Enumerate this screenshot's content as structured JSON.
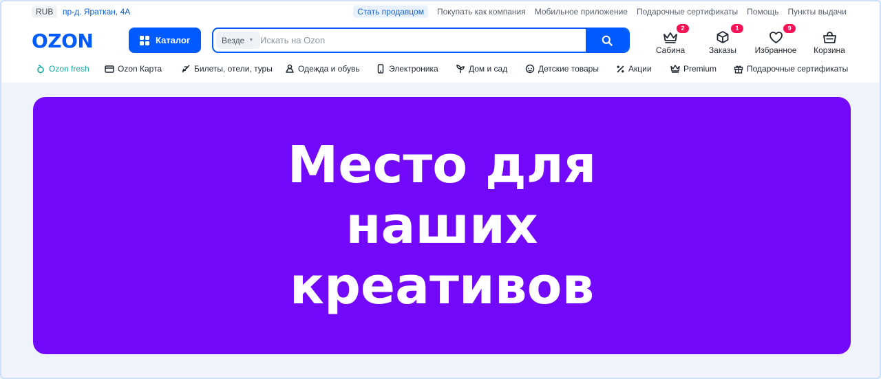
{
  "topbar": {
    "currency": "RUB",
    "address": "пр-д. Яраткан, 4А",
    "links": [
      "Стать продавцом",
      "Покупать как компания",
      "Мобильное приложение",
      "Подарочные сертификаты",
      "Помощь",
      "Пункты выдачи"
    ]
  },
  "header": {
    "logo": "OZON",
    "catalog_label": "Каталог",
    "search": {
      "scope": "Везде",
      "placeholder": "Искать на Ozon"
    },
    "actions": [
      {
        "label": "Сабина",
        "icon": "crown-icon",
        "badge": "2"
      },
      {
        "label": "Заказы",
        "icon": "box-icon",
        "badge": "1"
      },
      {
        "label": "Избранное",
        "icon": "heart-icon",
        "badge": "9"
      },
      {
        "label": "Корзина",
        "icon": "cart-icon",
        "badge": ""
      }
    ]
  },
  "categories": [
    {
      "label": "Ozon fresh",
      "icon": "fresh-icon"
    },
    {
      "label": "Ozon Карта",
      "icon": "card-icon"
    },
    {
      "label": "Билеты, отели, туры",
      "icon": "plane-icon"
    },
    {
      "label": "Одежда и обувь",
      "icon": "clothes-icon"
    },
    {
      "label": "Электроника",
      "icon": "phone-icon"
    },
    {
      "label": "Дом и сад",
      "icon": "plant-icon"
    },
    {
      "label": "Детские товары",
      "icon": "baby-icon"
    },
    {
      "label": "Акции",
      "icon": "percent-icon"
    },
    {
      "label": "Premium",
      "icon": "crown-icon"
    },
    {
      "label": "Подарочные сертификаты",
      "icon": "gift-icon"
    }
  ],
  "banner": {
    "text": "Место для наших креативов",
    "background": "#7209fb"
  },
  "colors": {
    "brand": "#005bff",
    "badge": "#f91155",
    "fresh": "#10a89e"
  }
}
